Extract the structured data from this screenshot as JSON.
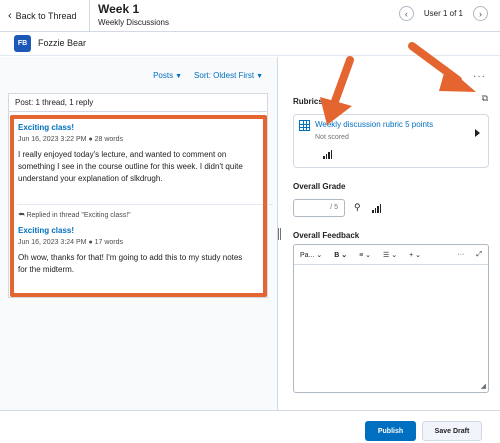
{
  "header": {
    "back_label": "Back to Thread",
    "title": "Week 1",
    "subtitle": "Weekly Discussions",
    "user_nav": "User 1 of 1"
  },
  "identity": {
    "initials": "FB",
    "name": "Fozzie Bear",
    "avatar_color": "#1c58b8"
  },
  "left_panel": {
    "filter_posts": "Posts",
    "sort_label": "Sort: Oldest First",
    "thread_summary": "Post: 1 thread, 1 reply",
    "posts": [
      {
        "title": "Exciting class!",
        "meta": "Jun 16, 2023 3:22 PM ● 28 words",
        "body": "I really enjoyed today's lecture, and wanted to comment on something I see in the course outline for this week. I didn't quite understand your explanation of slkdrugh."
      },
      {
        "replied_note": "Replied in thread \"Exciting class!\"",
        "title": "Exciting class!",
        "meta": "Jun 16, 2023 3:24 PM ● 17 words",
        "body": "Oh wow, thanks for that! I'm going to add this to my study notes for the midterm."
      }
    ]
  },
  "right_panel": {
    "more_icon": "ellipsis-icon",
    "rubrics_label": "Rubrics",
    "rubric": {
      "name": "Weekly discussion rubric 5 points",
      "status": "Not scored"
    },
    "overall_grade_label": "Overall Grade",
    "grade_suffix": "/ 5",
    "overall_feedback_label": "Overall Feedback",
    "toolbar": {
      "paragraph": "Pa...",
      "bold": "B",
      "align": "≡",
      "list": "☰",
      "insert": "+"
    }
  },
  "footer": {
    "publish_label": "Publish",
    "save_draft_label": "Save Draft"
  },
  "colors": {
    "accent": "#006fbf",
    "annotation": "#e4652f"
  }
}
